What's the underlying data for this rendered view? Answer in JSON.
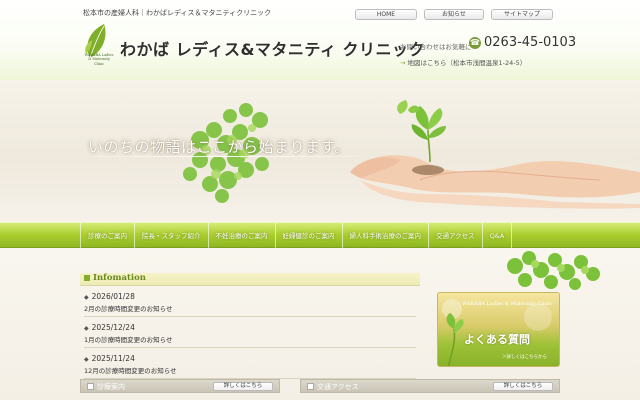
{
  "header": {
    "tagline": "松本市の産婦人科｜わかばレディス＆マタニティクリニック",
    "clinic_name": "わかば レディス&マタニティ クリニック",
    "logo_text": "WAKABA Ladies & Maternity Clinic",
    "contact_label": "お問い合わせはお気軽に",
    "phone": "0263-45-0103",
    "address_arrow": "→",
    "address": "地図はこちら（松本市浅間温泉1-24-5）"
  },
  "topnav": [
    "HOME",
    "お知らせ",
    "サイトマップ"
  ],
  "hero": {
    "copy": "いのちの物語はここから始まります。"
  },
  "mainnav": [
    "診療のご案内",
    "院長・スタッフ紹介",
    "不妊治療のご案内",
    "妊婦健診のご案内",
    "婦人科手術治療のご案内",
    "交通アクセス",
    "Q&A"
  ],
  "info": {
    "heading": "Infomation",
    "items": [
      {
        "date": "2026/01/28",
        "title": "2月の診療時間変更のお知らせ"
      },
      {
        "date": "2025/12/24",
        "title": "1月の診療時間変更のお知らせ"
      },
      {
        "date": "2025/11/24",
        "title": "12月の診療時間変更のお知らせ"
      }
    ]
  },
  "boxes": {
    "left": {
      "label": "診療案内",
      "more": "詳しくはこちら"
    },
    "right": {
      "label": "交通アクセス",
      "more": "詳しくはこちら"
    }
  },
  "faq": {
    "brand": "WAKABA Ladies & Maternity Clinic",
    "title": "よくある質問",
    "link": "＞詳しくはこちらから"
  },
  "colors": {
    "accent_green": "#a9cc2e",
    "dark_green": "#6a8a1f",
    "background": "#f3eee4"
  }
}
